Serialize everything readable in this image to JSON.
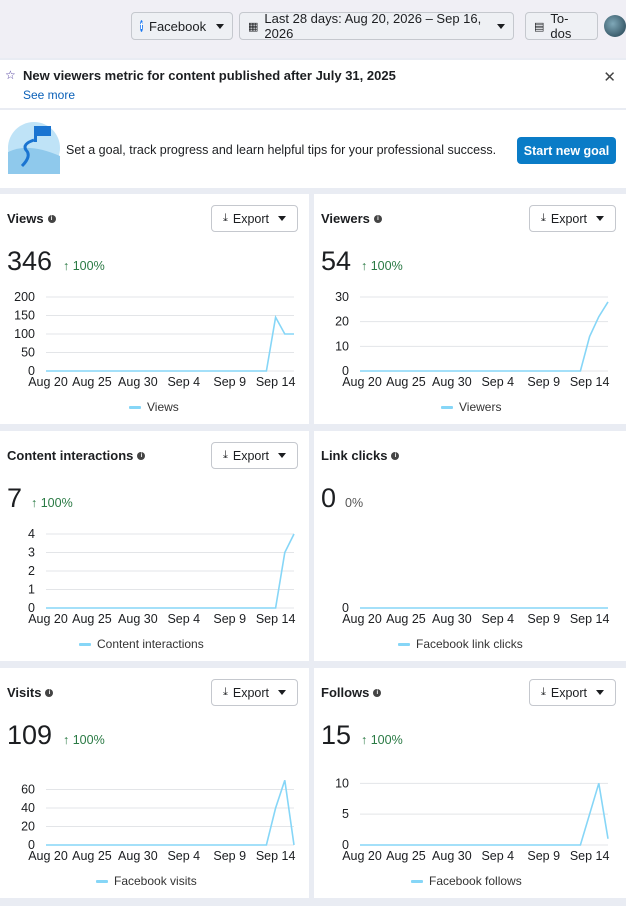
{
  "header": {
    "platform_label": "Facebook",
    "date_range_label": "Last 28 days: Aug 20, 2026 – Sep 16, 2026",
    "todos_label": "To-dos"
  },
  "notice": {
    "title": "New viewers metric for content published after July 31, 2025",
    "link": "See more"
  },
  "goal": {
    "text": "Set a goal, track progress and learn helpful tips for your professional success.",
    "button": "Start new goal"
  },
  "export_label": "Export",
  "x_ticks": [
    "Aug 20",
    "Aug 25",
    "Aug 30",
    "Sep 4",
    "Sep 9",
    "Sep 14"
  ],
  "cards": [
    {
      "title": "Views",
      "value": "346",
      "delta": "↑ 100%",
      "legend": "Views"
    },
    {
      "title": "Viewers",
      "value": "54",
      "delta": "↑ 100%",
      "legend": "Viewers"
    },
    {
      "title": "Content interactions",
      "value": "7",
      "delta": "↑ 100%",
      "legend": "Content interactions"
    },
    {
      "title": "Link clicks",
      "value": "0",
      "delta": "0%",
      "legend": "Facebook link clicks"
    },
    {
      "title": "Visits",
      "value": "109",
      "delta": "↑ 100%",
      "legend": "Facebook visits"
    },
    {
      "title": "Follows",
      "value": "15",
      "delta": "↑ 100%",
      "legend": "Facebook follows"
    }
  ],
  "chart_data": [
    {
      "type": "line",
      "title": "Views",
      "x": [
        "Aug 20",
        "Aug 21",
        "Aug 22",
        "Aug 23",
        "Aug 24",
        "Aug 25",
        "Aug 26",
        "Aug 27",
        "Aug 28",
        "Aug 29",
        "Aug 30",
        "Aug 31",
        "Sep 1",
        "Sep 2",
        "Sep 3",
        "Sep 4",
        "Sep 5",
        "Sep 6",
        "Sep 7",
        "Sep 8",
        "Sep 9",
        "Sep 10",
        "Sep 11",
        "Sep 12",
        "Sep 13",
        "Sep 14",
        "Sep 15",
        "Sep 16"
      ],
      "series": [
        {
          "name": "Views",
          "values": [
            0,
            0,
            0,
            0,
            0,
            0,
            0,
            0,
            0,
            0,
            0,
            0,
            0,
            0,
            0,
            0,
            0,
            0,
            0,
            0,
            0,
            0,
            0,
            0,
            0,
            145,
            100,
            100
          ]
        }
      ],
      "yticks": [
        0,
        50,
        100,
        150,
        200
      ],
      "ylim": [
        0,
        200
      ]
    },
    {
      "type": "line",
      "title": "Viewers",
      "x": [
        "Aug 20",
        "Aug 21",
        "Aug 22",
        "Aug 23",
        "Aug 24",
        "Aug 25",
        "Aug 26",
        "Aug 27",
        "Aug 28",
        "Aug 29",
        "Aug 30",
        "Aug 31",
        "Sep 1",
        "Sep 2",
        "Sep 3",
        "Sep 4",
        "Sep 5",
        "Sep 6",
        "Sep 7",
        "Sep 8",
        "Sep 9",
        "Sep 10",
        "Sep 11",
        "Sep 12",
        "Sep 13",
        "Sep 14",
        "Sep 15",
        "Sep 16"
      ],
      "series": [
        {
          "name": "Viewers",
          "values": [
            0,
            0,
            0,
            0,
            0,
            0,
            0,
            0,
            0,
            0,
            0,
            0,
            0,
            0,
            0,
            0,
            0,
            0,
            0,
            0,
            0,
            0,
            0,
            0,
            0,
            14,
            22,
            28
          ]
        }
      ],
      "yticks": [
        0,
        10,
        20,
        30
      ],
      "ylim": [
        0,
        30
      ]
    },
    {
      "type": "line",
      "title": "Content interactions",
      "x": [
        "Aug 20",
        "Aug 21",
        "Aug 22",
        "Aug 23",
        "Aug 24",
        "Aug 25",
        "Aug 26",
        "Aug 27",
        "Aug 28",
        "Aug 29",
        "Aug 30",
        "Aug 31",
        "Sep 1",
        "Sep 2",
        "Sep 3",
        "Sep 4",
        "Sep 5",
        "Sep 6",
        "Sep 7",
        "Sep 8",
        "Sep 9",
        "Sep 10",
        "Sep 11",
        "Sep 12",
        "Sep 13",
        "Sep 14",
        "Sep 15",
        "Sep 16"
      ],
      "series": [
        {
          "name": "Content interactions",
          "values": [
            0,
            0,
            0,
            0,
            0,
            0,
            0,
            0,
            0,
            0,
            0,
            0,
            0,
            0,
            0,
            0,
            0,
            0,
            0,
            0,
            0,
            0,
            0,
            0,
            0,
            0,
            3,
            4
          ]
        }
      ],
      "yticks": [
        0,
        1,
        2,
        3,
        4
      ],
      "ylim": [
        0,
        4
      ]
    },
    {
      "type": "line",
      "title": "Link clicks",
      "x": [
        "Aug 20",
        "Aug 21",
        "Aug 22",
        "Aug 23",
        "Aug 24",
        "Aug 25",
        "Aug 26",
        "Aug 27",
        "Aug 28",
        "Aug 29",
        "Aug 30",
        "Aug 31",
        "Sep 1",
        "Sep 2",
        "Sep 3",
        "Sep 4",
        "Sep 5",
        "Sep 6",
        "Sep 7",
        "Sep 8",
        "Sep 9",
        "Sep 10",
        "Sep 11",
        "Sep 12",
        "Sep 13",
        "Sep 14",
        "Sep 15",
        "Sep 16"
      ],
      "series": [
        {
          "name": "Facebook link clicks",
          "values": [
            0,
            0,
            0,
            0,
            0,
            0,
            0,
            0,
            0,
            0,
            0,
            0,
            0,
            0,
            0,
            0,
            0,
            0,
            0,
            0,
            0,
            0,
            0,
            0,
            0,
            0,
            0,
            0
          ]
        }
      ],
      "yticks": [
        0
      ],
      "ylim": [
        0,
        1
      ]
    },
    {
      "type": "line",
      "title": "Visits",
      "x": [
        "Aug 20",
        "Aug 21",
        "Aug 22",
        "Aug 23",
        "Aug 24",
        "Aug 25",
        "Aug 26",
        "Aug 27",
        "Aug 28",
        "Aug 29",
        "Aug 30",
        "Aug 31",
        "Sep 1",
        "Sep 2",
        "Sep 3",
        "Sep 4",
        "Sep 5",
        "Sep 6",
        "Sep 7",
        "Sep 8",
        "Sep 9",
        "Sep 10",
        "Sep 11",
        "Sep 12",
        "Sep 13",
        "Sep 14",
        "Sep 15",
        "Sep 16"
      ],
      "series": [
        {
          "name": "Facebook visits",
          "values": [
            0,
            0,
            0,
            0,
            0,
            0,
            0,
            0,
            0,
            0,
            0,
            0,
            0,
            0,
            0,
            0,
            0,
            0,
            0,
            0,
            0,
            0,
            0,
            0,
            0,
            40,
            70,
            0
          ]
        }
      ],
      "yticks": [
        0,
        20,
        40,
        60
      ],
      "ylim": [
        0,
        80
      ]
    },
    {
      "type": "line",
      "title": "Follows",
      "x": [
        "Aug 20",
        "Aug 21",
        "Aug 22",
        "Aug 23",
        "Aug 24",
        "Aug 25",
        "Aug 26",
        "Aug 27",
        "Aug 28",
        "Aug 29",
        "Aug 30",
        "Aug 31",
        "Sep 1",
        "Sep 2",
        "Sep 3",
        "Sep 4",
        "Sep 5",
        "Sep 6",
        "Sep 7",
        "Sep 8",
        "Sep 9",
        "Sep 10",
        "Sep 11",
        "Sep 12",
        "Sep 13",
        "Sep 14",
        "Sep 15",
        "Sep 16"
      ],
      "series": [
        {
          "name": "Facebook follows",
          "values": [
            0,
            0,
            0,
            0,
            0,
            0,
            0,
            0,
            0,
            0,
            0,
            0,
            0,
            0,
            0,
            0,
            0,
            0,
            0,
            0,
            0,
            0,
            0,
            0,
            0,
            5,
            10,
            1
          ]
        }
      ],
      "yticks": [
        0,
        5,
        10
      ],
      "ylim": [
        0,
        12
      ]
    }
  ],
  "colors": {
    "line": "#86d6f7",
    "accent": "#0a7cc7",
    "positive": "#2a7a44"
  }
}
